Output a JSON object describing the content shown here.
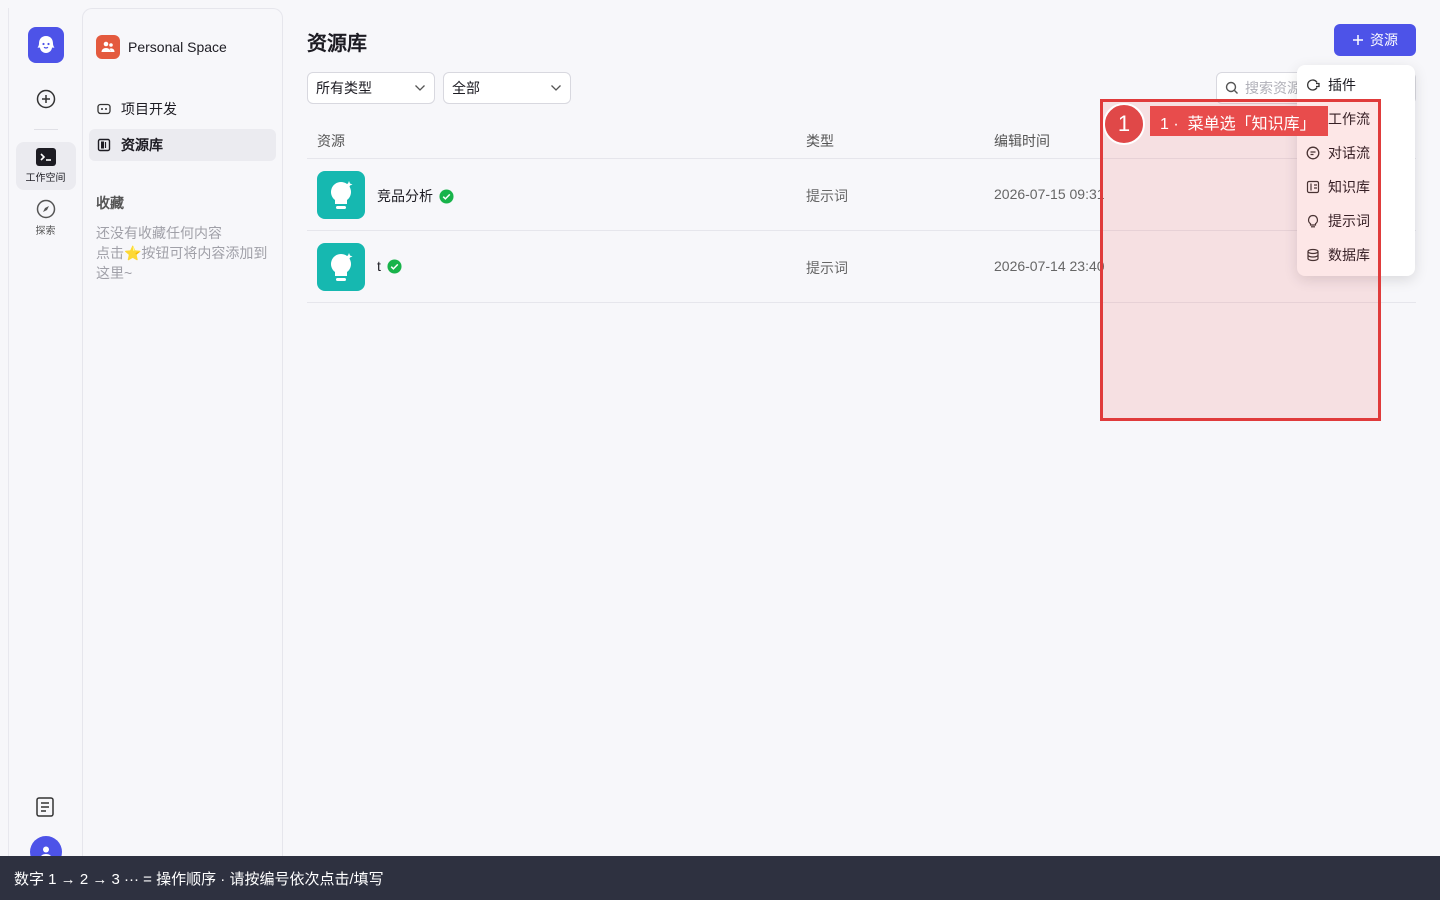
{
  "rail": {
    "workspace_label": "工作空间",
    "explore_label": "探索"
  },
  "panel": {
    "space_name": "Personal Space",
    "nav": [
      {
        "label": "项目开发",
        "icon": "robot-icon"
      },
      {
        "label": "资源库",
        "icon": "library-icon"
      }
    ],
    "favorites_title": "收藏",
    "favorites_empty": "还没有收藏任何内容\n点击⭐按钮可将内容添加到这里~"
  },
  "main": {
    "title": "资源库",
    "add_button_label": "资源",
    "filter_type": "所有类型",
    "filter_scope": "全部",
    "search_placeholder": "搜索资源",
    "columns": [
      "资源",
      "类型",
      "编辑时间"
    ],
    "rows": [
      {
        "name": "竞品分析",
        "type": "提示词",
        "time": "2026-07-15 09:31"
      },
      {
        "name": "t",
        "type": "提示词",
        "time": "2026-07-14 23:40"
      }
    ]
  },
  "menu": {
    "items": [
      "插件",
      "工作流",
      "对话流",
      "知识库",
      "提示词",
      "数据库"
    ]
  },
  "annotation": {
    "badge": "1",
    "label": "1 ·  菜单选「知识库」"
  },
  "footer": {
    "text": "数字 1 → 2 → 3 ··· = 操作顺序 ·   请按编号依次点击/填写"
  },
  "colors": {
    "accent": "#4d53e8",
    "prompt_icon_bg": "#16b8b0",
    "annotation_red": "#e03b3b",
    "verified_green": "#18b34a"
  }
}
